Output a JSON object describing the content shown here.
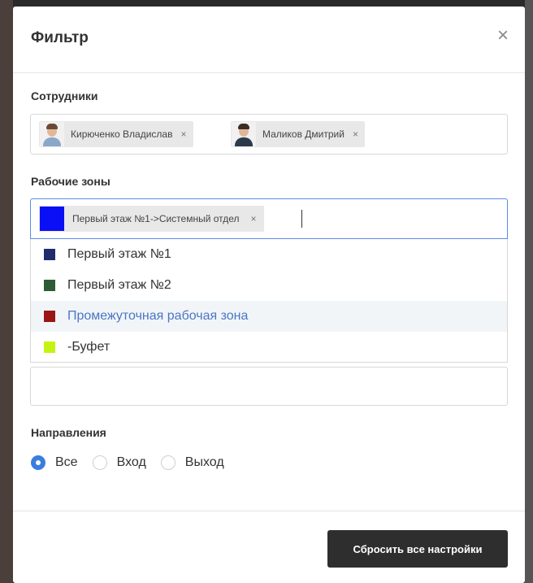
{
  "modal": {
    "title": "Фильтр",
    "close_icon": "×"
  },
  "employees": {
    "label": "Сотрудники",
    "tags": [
      {
        "name": "Кирюченко Владислав",
        "remove": "×"
      },
      {
        "name": "Маликов Дмитрий",
        "remove": "×"
      }
    ]
  },
  "zones": {
    "label": "Рабочие зоны",
    "selected": {
      "name": "Первый этаж №1->Системный отдел",
      "color": "#0a0ff5",
      "remove": "×"
    },
    "options": [
      {
        "label": "Первый этаж №1",
        "color": "#1f2d6b"
      },
      {
        "label": "Первый этаж №2",
        "color": "#2d5c34"
      },
      {
        "label": "Промежуточная рабочая зона",
        "color": "#9b1515"
      },
      {
        "label": "-Буфет",
        "color": "#c5f312"
      }
    ]
  },
  "directions": {
    "label": "Направления",
    "options": [
      "Все",
      "Вход",
      "Выход"
    ],
    "selected": "Все"
  },
  "footer": {
    "reset_label": "Сбросить все настройки"
  }
}
